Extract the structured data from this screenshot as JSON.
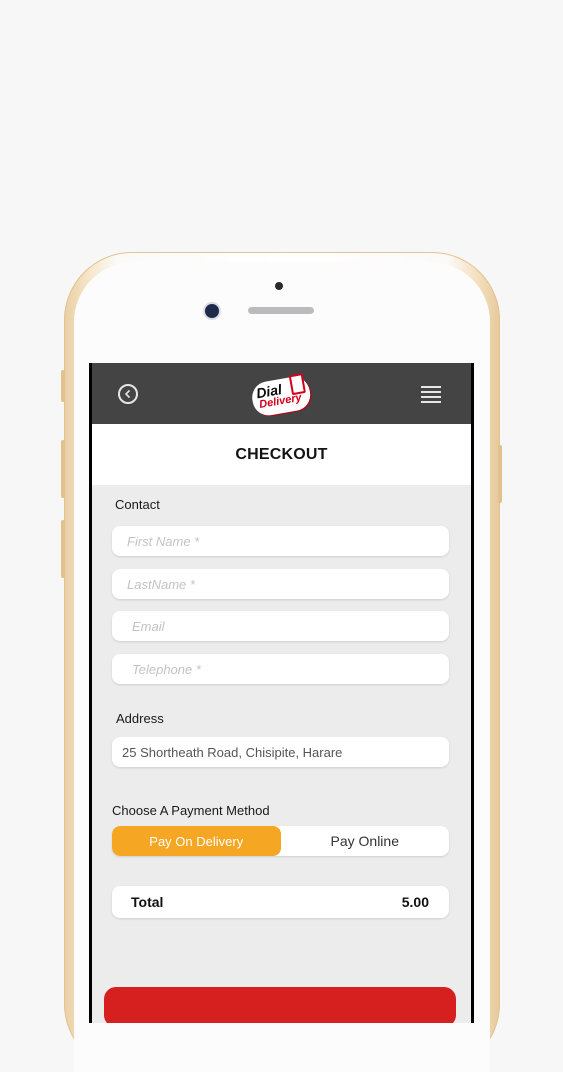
{
  "app": {
    "logo": {
      "word1": "Dial",
      "word2": "Delivery",
      "amp": "&"
    }
  },
  "page": {
    "title": "CHECKOUT"
  },
  "contact": {
    "label": "Contact",
    "first_name_placeholder": "First Name *",
    "last_name_placeholder": "LastName *",
    "email_placeholder": "Email",
    "telephone_placeholder": "Telephone *"
  },
  "address": {
    "label": "Address",
    "value": "25 Shortheath Road, Chisipite, Harare"
  },
  "payment": {
    "label": "Choose A Payment Method",
    "options": [
      "Pay On Delivery",
      "Pay Online"
    ],
    "selected": "Pay On Delivery"
  },
  "total": {
    "label": "Total",
    "value": "5.00"
  },
  "colors": {
    "topbar": "#444444",
    "accent_orange": "#f5a623",
    "brand_red": "#d40018",
    "confirm_red": "#d61f1f",
    "phone_gold": "#e6c99b"
  },
  "icons": {
    "back": "back-arrow-circle-icon",
    "menu": "hamburger-menu-icon"
  }
}
